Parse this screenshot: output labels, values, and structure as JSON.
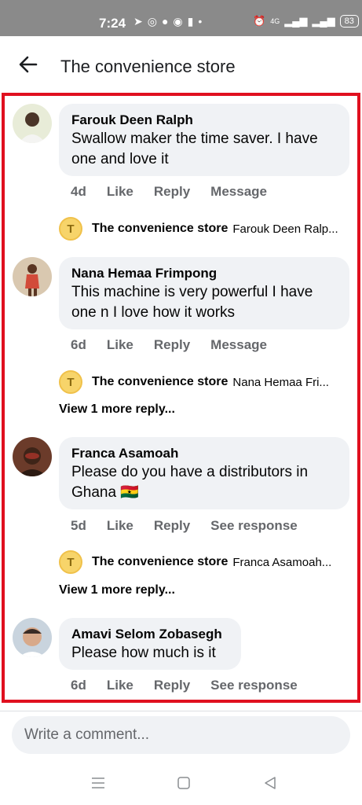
{
  "status_bar": {
    "time": "7:24",
    "battery": "83",
    "network": "4G"
  },
  "header": {
    "title": "The convenience store",
    "back_icon": "arrow-left-icon"
  },
  "comments": [
    {
      "author": "Farouk Deen Ralph",
      "text_lines": [
        "Swallow maker the time saver. I have",
        "one and love it"
      ],
      "time": "4d",
      "like": "Like",
      "reply": "Reply",
      "extra": "Message",
      "reply_preview": {
        "avatar_letter": "T",
        "author": "The convenience store",
        "preview": "Farouk Deen Ralp..."
      }
    },
    {
      "author": "Nana Hemaa Frimpong",
      "text_lines": [
        "This machine is very powerful I have",
        "one n I love how it works"
      ],
      "time": "6d",
      "like": "Like",
      "reply": "Reply",
      "extra": "Message",
      "reply_preview": {
        "avatar_letter": "T",
        "author": "The convenience store",
        "preview": "Nana Hemaa Fri..."
      },
      "more_replies": "View 1 more reply..."
    },
    {
      "author": "Franca Asamoah",
      "text_lines": [
        "Please do you have a distributors in",
        "Ghana 🇬🇭"
      ],
      "time": "5d",
      "like": "Like",
      "reply": "Reply",
      "extra": "See response",
      "reply_preview": {
        "avatar_letter": "T",
        "author": "The convenience store",
        "preview": "Franca Asamoah..."
      },
      "more_replies": "View 1 more reply..."
    },
    {
      "author": "Amavi Selom Zobasegh",
      "text_lines": [
        "Please how much is it"
      ],
      "time": "6d",
      "like": "Like",
      "reply": "Reply",
      "extra": "See response"
    }
  ],
  "composer": {
    "placeholder": "Write a comment..."
  },
  "colors": {
    "highlight": "#e0101f",
    "bubble": "#f0f2f5",
    "meta": "#65676b",
    "status_bar": "#8a8a8a"
  }
}
